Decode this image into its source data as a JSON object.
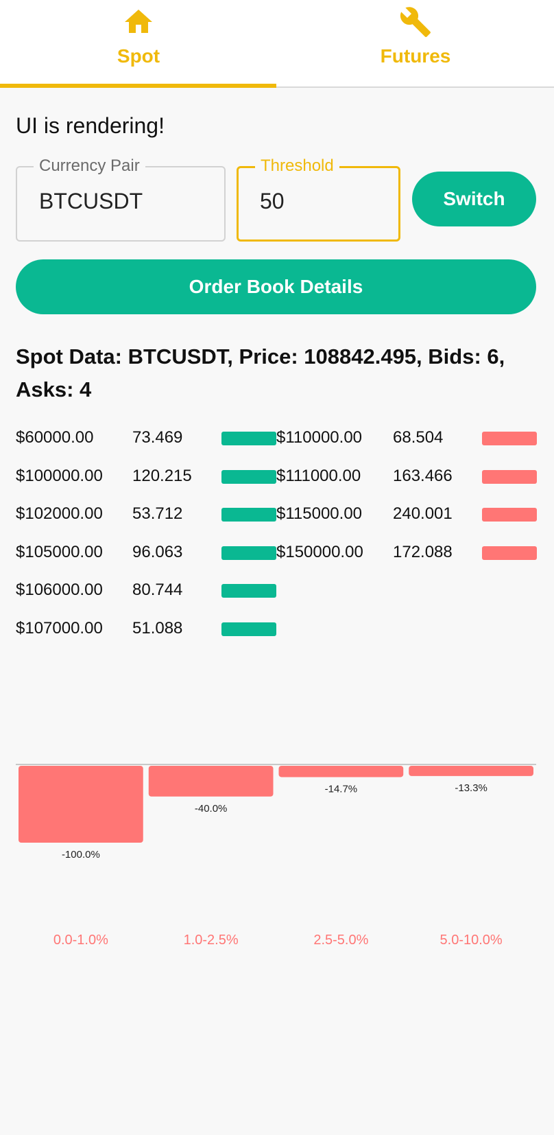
{
  "tabs": [
    {
      "label": "Spot",
      "icon": "home-icon",
      "active": true
    },
    {
      "label": "Futures",
      "icon": "wrench-icon",
      "active": false
    }
  ],
  "status": "UI is rendering!",
  "currency_pair": {
    "label": "Currency Pair",
    "value": "BTCUSDT"
  },
  "threshold": {
    "label": "Threshold",
    "value": "50"
  },
  "switch_label": "Switch",
  "order_book_label": "Order Book Details",
  "headline": "Spot Data: BTCUSDT, Price: 108842.495, Bids: 6, Asks: 4",
  "colors": {
    "accent": "#f0b90b",
    "bid": "#0ab892",
    "ask": "#ff7675"
  },
  "bids": [
    {
      "price": "$60000.00",
      "qty": "73.469"
    },
    {
      "price": "$100000.00",
      "qty": "120.215"
    },
    {
      "price": "$102000.00",
      "qty": "53.712"
    },
    {
      "price": "$105000.00",
      "qty": "96.063"
    },
    {
      "price": "$106000.00",
      "qty": "80.744"
    },
    {
      "price": "$107000.00",
      "qty": "51.088"
    }
  ],
  "asks": [
    {
      "price": "$110000.00",
      "qty": "68.504"
    },
    {
      "price": "$111000.00",
      "qty": "163.466"
    },
    {
      "price": "$115000.00",
      "qty": "240.001"
    },
    {
      "price": "$150000.00",
      "qty": "172.088"
    }
  ],
  "chart_data": {
    "type": "bar",
    "categories": [
      "0.0-1.0%",
      "1.0-2.5%",
      "2.5-5.0%",
      "5.0-10.0%"
    ],
    "values": [
      -100.0,
      -40.0,
      -14.7,
      -13.3
    ],
    "value_labels": [
      "-100.0%",
      "-40.0%",
      "-14.7%",
      "-13.3%"
    ],
    "ylim": [
      -100,
      0
    ],
    "grid": false,
    "color": "#ff7675"
  }
}
